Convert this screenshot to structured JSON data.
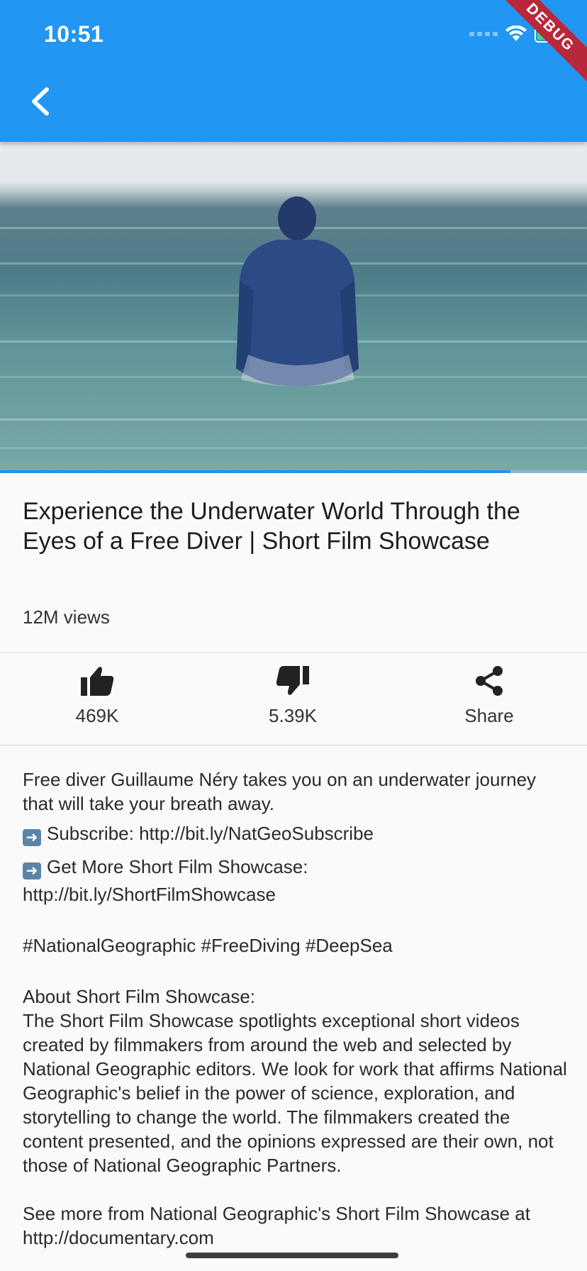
{
  "status_bar": {
    "time": "10:51"
  },
  "debug_banner": "DEBUG",
  "video": {
    "progress_fraction": 0.87
  },
  "video_info": {
    "title": "Experience the Underwater World Through the Eyes of a Free Diver | Short Film Showcase",
    "views": "12M views"
  },
  "actions": {
    "like": "469K",
    "dislike": "5.39K",
    "share": "Share"
  },
  "description": {
    "intro": "Free diver Guillaume Néry takes you on an underwater journey that will take your breath away.",
    "subscribe": "Subscribe: http://bit.ly/NatGeoSubscribe",
    "more_label": "Get More Short Film Showcase:",
    "more_link": "http://bit.ly/ShortFilmShowcase",
    "hashtags": "#NationalGeographic #FreeDiving #DeepSea",
    "about_heading": "About Short Film Showcase:",
    "about_body": "The Short Film Showcase spotlights exceptional short videos created by filmmakers from around the web and selected by National Geographic editors. We look for work that affirms National Geographic's belief in the power of science, exploration, and storytelling to change the world. The filmmakers created the content presented, and the opinions expressed are their own, not those of National Geographic Partners.",
    "see_more": "See more from National Geographic's Short Film Showcase at http://documentary.com"
  },
  "colors": {
    "app_bar": "#2196f3",
    "debug_ribbon": "#b8283b",
    "background": "#fafafa"
  },
  "icons": [
    "back-icon",
    "wifi-icon",
    "battery-icon",
    "thumb-up-icon",
    "thumb-down-icon",
    "share-icon"
  ]
}
